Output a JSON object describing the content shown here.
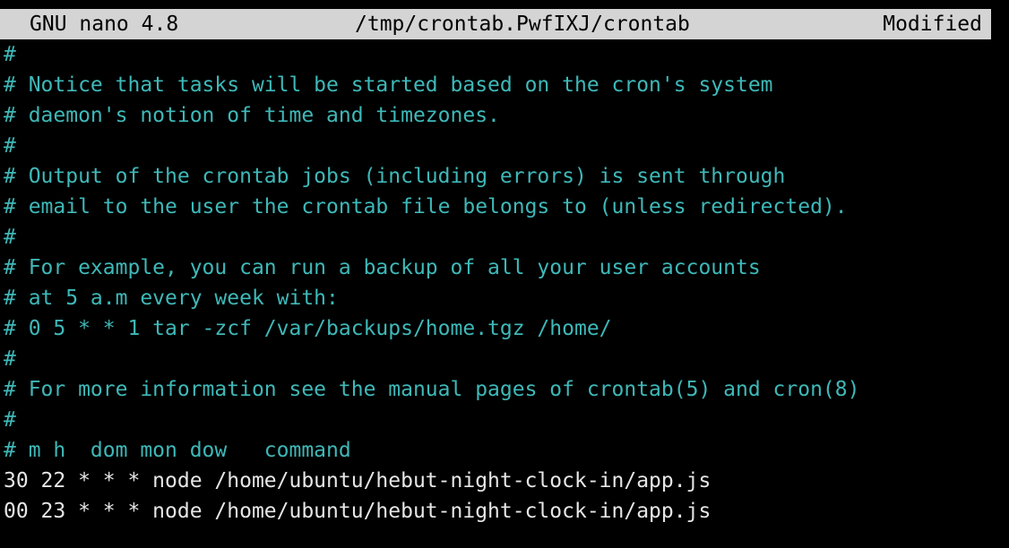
{
  "colors": {
    "background": "#000000",
    "titlebar_bg": "#d4d4d4",
    "comment": "#3fb8b8",
    "code": "#e6e6e6"
  },
  "titlebar": {
    "app": "GNU nano 4.8",
    "file": "/tmp/crontab.PwfIXJ/crontab",
    "status": "Modified"
  },
  "buffer": {
    "lines": [
      {
        "text": "#",
        "type": "comment"
      },
      {
        "text": "# Notice that tasks will be started based on the cron's system",
        "type": "comment"
      },
      {
        "text": "# daemon's notion of time and timezones.",
        "type": "comment"
      },
      {
        "text": "#",
        "type": "comment"
      },
      {
        "text": "# Output of the crontab jobs (including errors) is sent through",
        "type": "comment"
      },
      {
        "text": "# email to the user the crontab file belongs to (unless redirected).",
        "type": "comment"
      },
      {
        "text": "#",
        "type": "comment"
      },
      {
        "text": "# For example, you can run a backup of all your user accounts",
        "type": "comment"
      },
      {
        "text": "# at 5 a.m every week with:",
        "type": "comment"
      },
      {
        "text": "# 0 5 * * 1 tar -zcf /var/backups/home.tgz /home/",
        "type": "comment"
      },
      {
        "text": "#",
        "type": "comment"
      },
      {
        "text": "# For more information see the manual pages of crontab(5) and cron(8)",
        "type": "comment"
      },
      {
        "text": "#",
        "type": "comment"
      },
      {
        "text": "# m h  dom mon dow   command",
        "type": "comment"
      },
      {
        "text": "30 22 * * * node /home/ubuntu/hebut-night-clock-in/app.js",
        "type": "code"
      },
      {
        "text": "00 23 * * * node /home/ubuntu/hebut-night-clock-in/app.js",
        "type": "code"
      }
    ]
  }
}
